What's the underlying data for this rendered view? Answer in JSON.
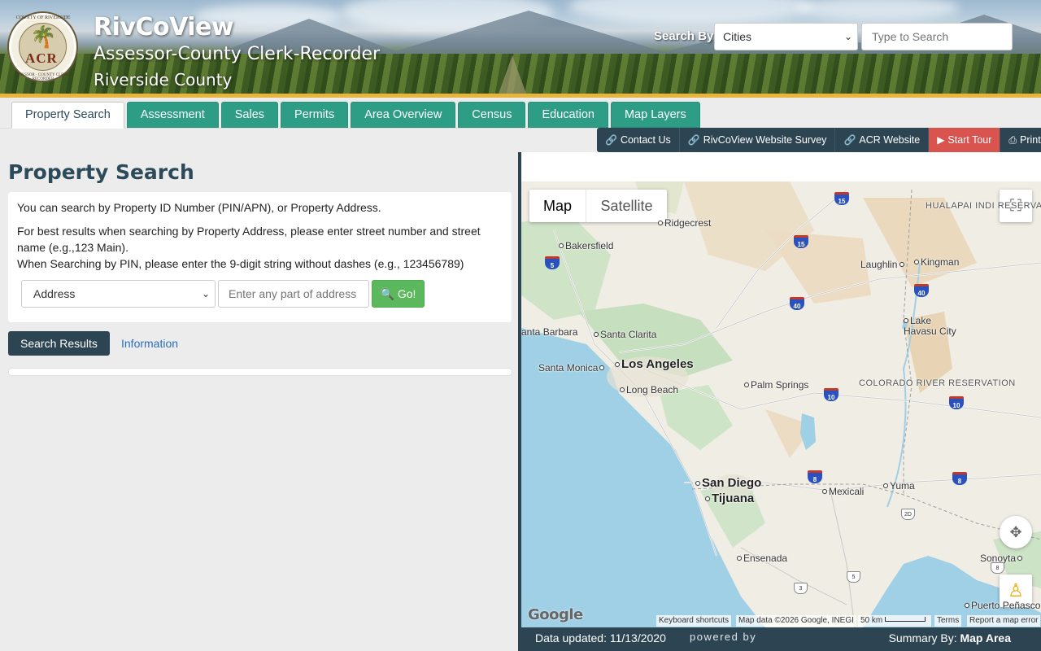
{
  "header": {
    "title": "RivCoView",
    "subtitle": "Assessor-County Clerk-Recorder",
    "county": "Riverside County",
    "seal_text_top": "COUNTY OF RIVERSIDE",
    "seal_text_bottom": "ASSESSOR · COUNTY CLERK · RECORDER",
    "seal_acr": "ACR",
    "search_by_label": "Search By:",
    "search_by_selected": "Cities",
    "search_placeholder": "Type to Search"
  },
  "tabs": [
    {
      "label": "Property Search",
      "active": true
    },
    {
      "label": "Assessment"
    },
    {
      "label": "Sales"
    },
    {
      "label": "Permits"
    },
    {
      "label": "Area Overview"
    },
    {
      "label": "Census"
    },
    {
      "label": "Education"
    },
    {
      "label": "Map Layers"
    }
  ],
  "toolbar": {
    "contact": "Contact Us",
    "survey": "RivCoView Website Survey",
    "acr": "ACR Website",
    "tour": "Start Tour",
    "print": "Print"
  },
  "property_search": {
    "title": "Property Search",
    "help1": "You can search by Property ID Number (PIN/APN), or Property Address.",
    "help2": "For best results when searching by Property Address, please enter street number and street name (e.g.,123 Main).",
    "help3": "When Searching by PIN, please enter the 9-digit string without dashes (e.g., 123456789)",
    "search_type_selected": "Address",
    "address_placeholder": "Enter any part of address",
    "go_label": "Go!",
    "results_tab": "Search Results",
    "info_tab": "Information"
  },
  "map": {
    "type_map": "Map",
    "type_satellite": "Satellite",
    "labels": {
      "ridgecrest": "Ridgecrest",
      "bakersfield": "Bakersfield",
      "hualapai": "HUALAPAI INDI RESERVATION",
      "laughlin": "Laughlin",
      "kingman": "Kingman",
      "lake_havasu": "Lake Havasu City",
      "santa_barbara": "anta Barbara",
      "santa_clarita": "Santa Clarita",
      "los_angeles": "Los Angeles",
      "santa_monica": "Santa Monica",
      "long_beach": "Long Beach",
      "palm_springs": "Palm Springs",
      "colorado_river": "COLORADO RIVER RESERVATION",
      "san_diego": "San Diego",
      "tijuana": "Tijuana",
      "mexicali": "Mexicali",
      "yuma": "Yuma",
      "ensenada": "Ensenada",
      "sonoyta": "Sonoyta",
      "puerto_penasco": "Puerto Peñasco"
    },
    "shields": {
      "i15a": "15",
      "i15b": "15",
      "i5": "5",
      "i40a": "40",
      "i40b": "40",
      "i10a": "10",
      "i10b": "10",
      "i8a": "8",
      "i8b": "8",
      "r2d": "2D",
      "r3": "3",
      "r5": "5",
      "r8": "8"
    },
    "attribution": {
      "keyboard": "Keyboard shortcuts",
      "data": "Map data ©2026 Google, INEGI",
      "scale": "50 km",
      "terms": "Terms",
      "report": "Report a map error",
      "logo": "Google"
    }
  },
  "status_bar": {
    "data_updated": "Data updated: 11/13/2020",
    "powered_by": "powered by",
    "summary_prefix": "Summary By:",
    "summary_value": "Map Area"
  },
  "colors": {
    "accent_teal": "#2e9d86",
    "navy": "#2d4453",
    "go_green": "#5cb85c",
    "tour_red": "#d9534f",
    "gold_bar": "#e8b53a"
  }
}
